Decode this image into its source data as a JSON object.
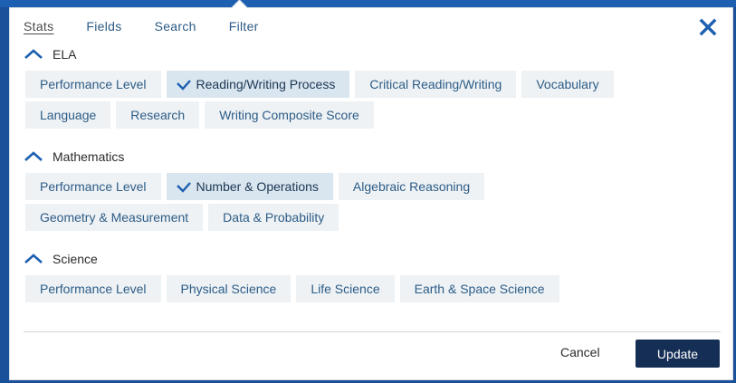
{
  "tabs": [
    {
      "label": "Stats"
    },
    {
      "label": "Fields"
    },
    {
      "label": "Search"
    },
    {
      "label": "Filter"
    }
  ],
  "active_tab": "Stats",
  "close_icon": "close-icon",
  "sections": [
    {
      "title": "ELA",
      "rows": [
        [
          {
            "label": "Performance Level",
            "selected": false
          },
          {
            "label": "Reading/Writing Process",
            "selected": true
          },
          {
            "label": "Critical Reading/Writing",
            "selected": false
          },
          {
            "label": "Vocabulary",
            "selected": false
          }
        ],
        [
          {
            "label": "Language",
            "selected": false
          },
          {
            "label": "Research",
            "selected": false
          },
          {
            "label": "Writing Composite Score",
            "selected": false
          }
        ]
      ]
    },
    {
      "title": "Mathematics",
      "rows": [
        [
          {
            "label": "Performance Level",
            "selected": false
          },
          {
            "label": "Number & Operations",
            "selected": true
          },
          {
            "label": "Algebraic Reasoning",
            "selected": false
          }
        ],
        [
          {
            "label": "Geometry & Measurement",
            "selected": false
          },
          {
            "label": "Data & Probability",
            "selected": false
          }
        ]
      ]
    },
    {
      "title": "Science",
      "rows": [
        [
          {
            "label": "Performance Level",
            "selected": false
          },
          {
            "label": "Physical Science",
            "selected": false
          },
          {
            "label": "Life Science",
            "selected": false
          },
          {
            "label": "Earth & Space Science",
            "selected": false
          }
        ]
      ]
    }
  ],
  "footer": {
    "cancel_label": "Cancel",
    "update_label": "Update"
  },
  "colors": {
    "accent": "#1d5fb0",
    "chip_bg": "#eef2f5",
    "chip_selected_bg": "#d9e6ef",
    "chip_text": "#2d5c86",
    "update_bg": "#142e55"
  }
}
